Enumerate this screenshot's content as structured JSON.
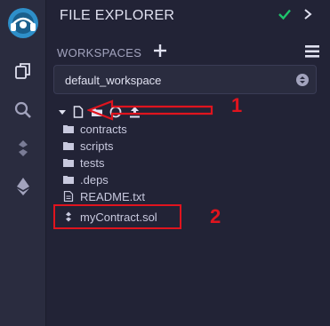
{
  "activity_bar": {
    "icons": [
      "remix-logo",
      "files-icon",
      "search-icon",
      "solidity-compiler-icon",
      "deploy-run-icon"
    ]
  },
  "panel": {
    "title": "FILE EXPLORER",
    "workspaces_label": "WORKSPACES",
    "workspace_selected": "default_workspace"
  },
  "toolbar": {
    "icons": [
      "caret-down-icon",
      "new-file-icon",
      "new-folder-icon",
      "github-icon",
      "upload-icon"
    ]
  },
  "tree": {
    "items": [
      {
        "label": "contracts",
        "icon": "folder-icon"
      },
      {
        "label": "scripts",
        "icon": "folder-icon"
      },
      {
        "label": "tests",
        "icon": "folder-icon"
      },
      {
        "label": ".deps",
        "icon": "folder-icon"
      },
      {
        "label": "README.txt",
        "icon": "file-icon"
      },
      {
        "label": "myContract.sol",
        "icon": "solidity-file-icon"
      }
    ]
  },
  "annotations": {
    "label_1": "1",
    "label_2": "2"
  },
  "colors": {
    "background": "#222336",
    "activity_bar": "#2a2c3f",
    "accent_green": "#1ec46c",
    "annotation_red": "#e0141e",
    "logo_blue": "#2e8fc9"
  }
}
